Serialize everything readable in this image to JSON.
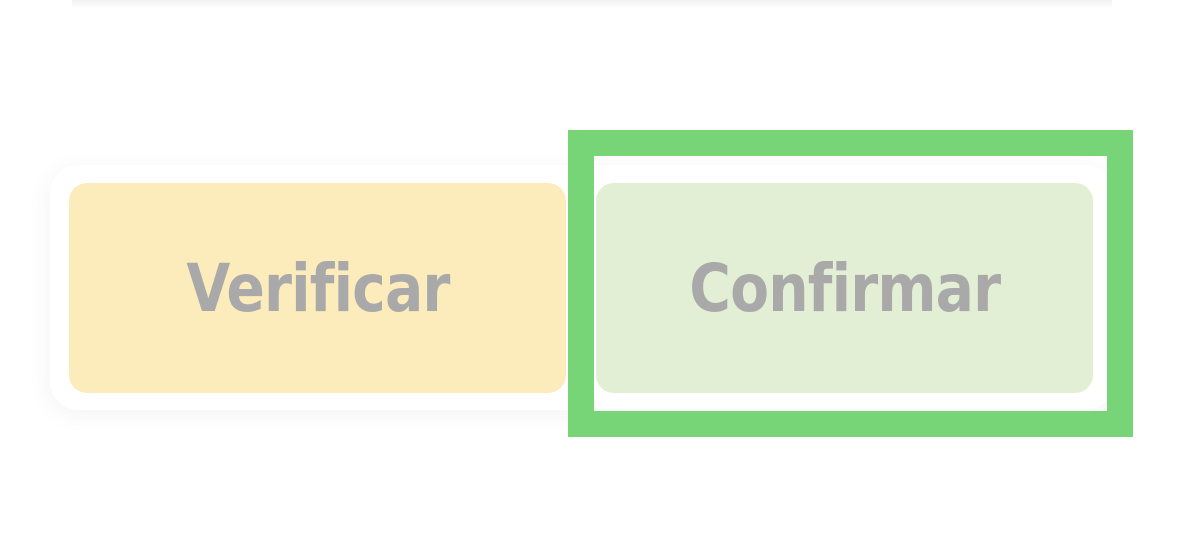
{
  "buttons": {
    "verify_label": "Verificar",
    "confirm_label": "Confirmar"
  },
  "colors": {
    "verify_bg": "#fcecbb",
    "confirm_bg": "#e2efd4",
    "label_text": "#a9a9a9",
    "highlight": "#78d577"
  }
}
